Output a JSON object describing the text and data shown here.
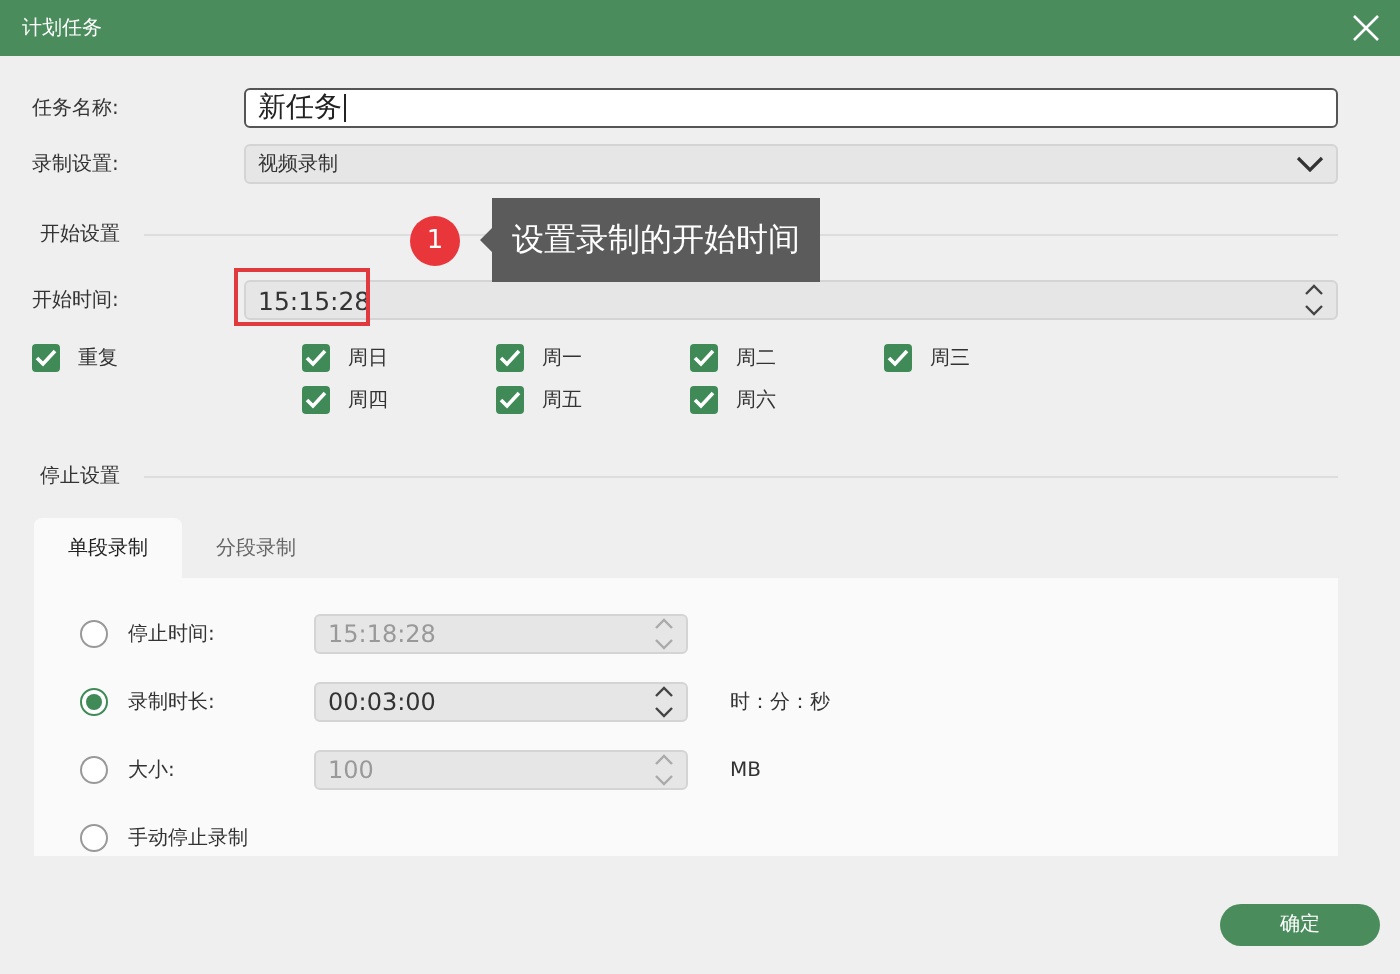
{
  "window": {
    "title": "计划任务"
  },
  "task_name": {
    "label": "任务名称:",
    "value": "新任务"
  },
  "record_setting": {
    "label": "录制设置:",
    "value": "视频录制"
  },
  "start_section": {
    "title": "开始设置"
  },
  "start_time": {
    "label": "开始时间:",
    "value": "15:15:28",
    "highlighted": true
  },
  "callout": {
    "number": "1",
    "text": "设置录制的开始时间"
  },
  "repeat": {
    "label": "重复",
    "checked": true
  },
  "weekdays": [
    {
      "label": "周日",
      "checked": true
    },
    {
      "label": "周一",
      "checked": true
    },
    {
      "label": "周二",
      "checked": true
    },
    {
      "label": "周三",
      "checked": true
    },
    {
      "label": "周四",
      "checked": true
    },
    {
      "label": "周五",
      "checked": true
    },
    {
      "label": "周六",
      "checked": true
    }
  ],
  "stop_section": {
    "title": "停止设置"
  },
  "tabs": [
    {
      "label": "单段录制",
      "selected": true
    },
    {
      "label": "分段录制",
      "selected": false
    }
  ],
  "stop_options": [
    {
      "label": "停止时间:",
      "selected": false,
      "value": "15:18:28"
    },
    {
      "label": "录制时长:",
      "selected": true,
      "value": "00:03:00",
      "unit": "时：分：秒"
    },
    {
      "label": "大小:",
      "selected": false,
      "value": "100",
      "unit": "MB"
    },
    {
      "label": "手动停止录制",
      "selected": false
    }
  ],
  "buttons": [
    "确定"
  ]
}
